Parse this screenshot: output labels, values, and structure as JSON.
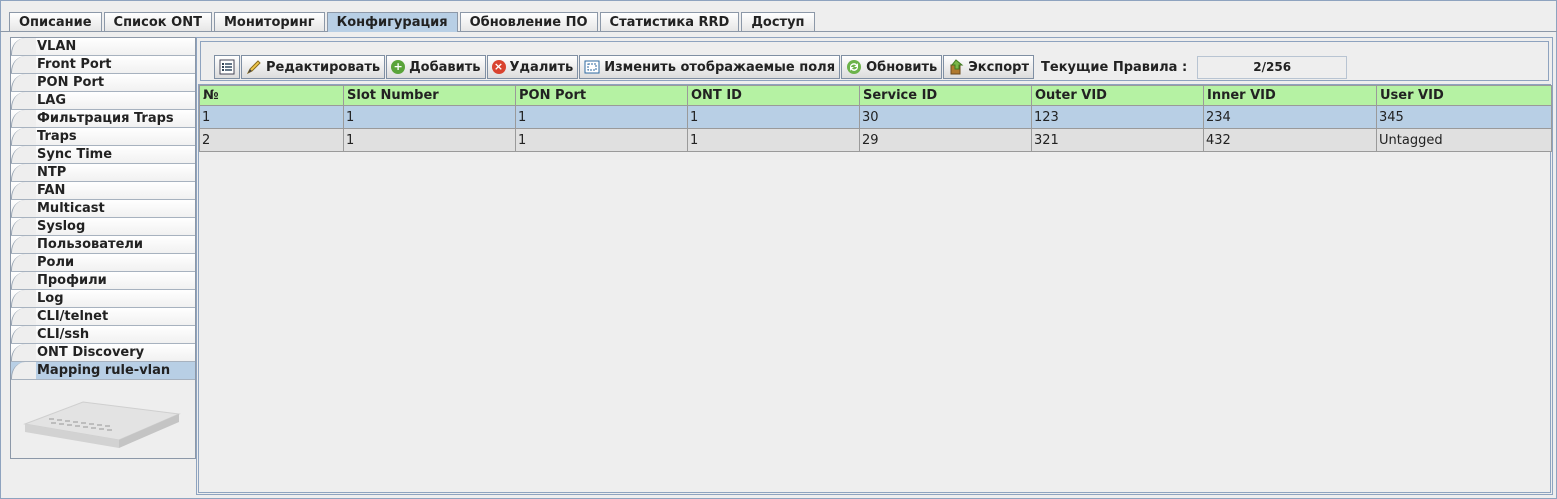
{
  "top_tabs": [
    {
      "label": "Описание",
      "active": false
    },
    {
      "label": "Список ONT",
      "active": false
    },
    {
      "label": "Мониторинг",
      "active": false
    },
    {
      "label": "Конфигурация",
      "active": true
    },
    {
      "label": "Обновление ПО",
      "active": false
    },
    {
      "label": "Статистика RRD",
      "active": false
    },
    {
      "label": "Доступ",
      "active": false
    }
  ],
  "sidebar": {
    "items": [
      {
        "label": "VLAN"
      },
      {
        "label": "Front Port"
      },
      {
        "label": "PON Port"
      },
      {
        "label": "LAG"
      },
      {
        "label": "Фильтрация Traps"
      },
      {
        "label": "Traps"
      },
      {
        "label": "Sync Time"
      },
      {
        "label": "NTP"
      },
      {
        "label": "FAN"
      },
      {
        "label": "Multicast"
      },
      {
        "label": "Syslog"
      },
      {
        "label": "Пользователи"
      },
      {
        "label": "Роли"
      },
      {
        "label": "Профили"
      },
      {
        "label": "Log"
      },
      {
        "label": "CLI/telnet"
      },
      {
        "label": "CLI/ssh"
      },
      {
        "label": "ONT Discovery"
      },
      {
        "label": "Mapping rule-vlan"
      }
    ],
    "active_item": "Mapping rule-vlan",
    "device_image": "olt-device-image"
  },
  "toolbar": {
    "list_icon": "list-icon",
    "edit_label": "Редактировать",
    "add_label": "Добавить",
    "delete_label": "Удалить",
    "fields_label": "Изменить отображаемые поля",
    "refresh_label": "Обновить",
    "export_label": "Экспорт",
    "rules_label": "Текущие Правила :",
    "rules_value": "2/256"
  },
  "table": {
    "columns": [
      "№",
      "Slot Number",
      "PON Port",
      "ONT ID",
      "Service ID",
      "Outer VID",
      "Inner VID",
      "User VID"
    ],
    "rows": [
      [
        "1",
        "1",
        "1",
        "1",
        "30",
        "123",
        "234",
        "345"
      ],
      [
        "2",
        "1",
        "1",
        "1",
        "29",
        "321",
        "432",
        "Untagged"
      ]
    ],
    "selected_row": 0
  },
  "colors": {
    "accent": "#b8cfe5",
    "header_bg": "#b5f2a3",
    "background": "#eeeeee"
  }
}
